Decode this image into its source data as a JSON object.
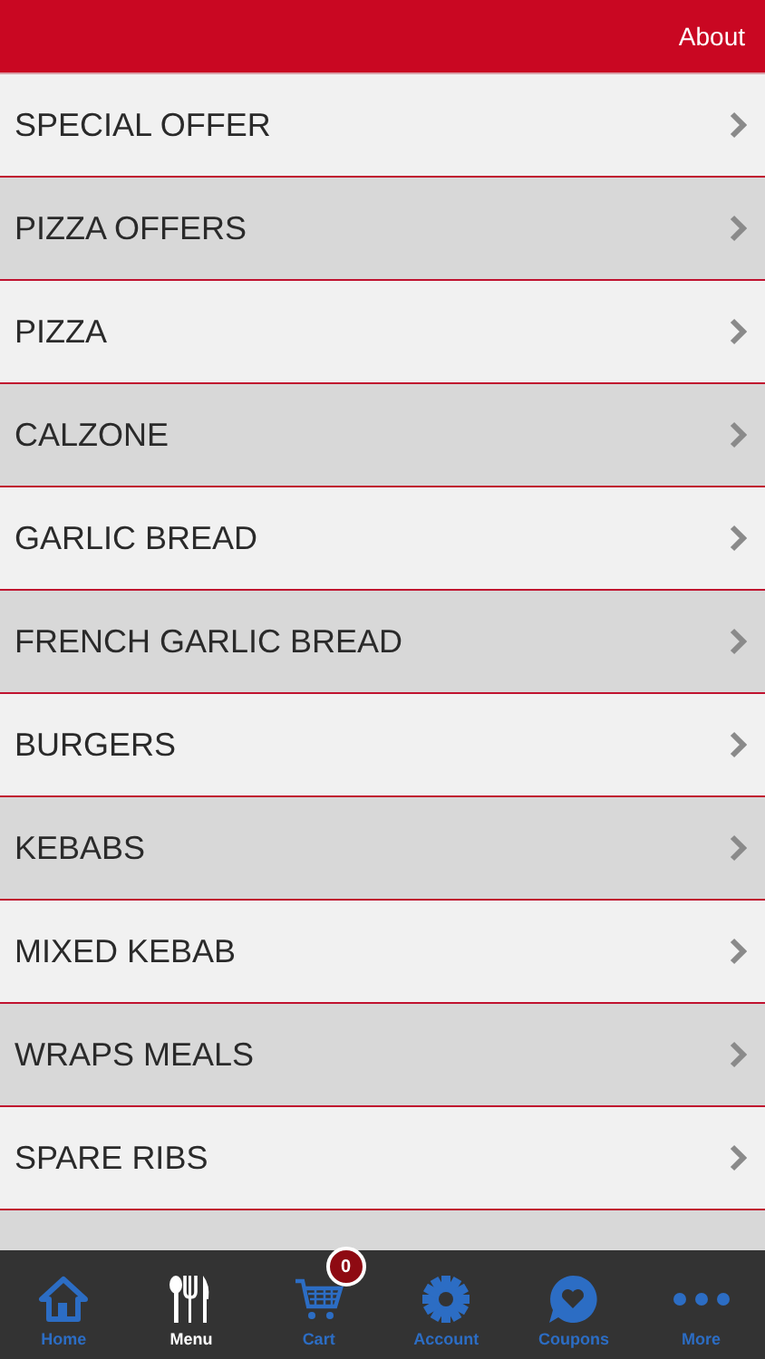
{
  "header": {
    "about": "About"
  },
  "menu_items": [
    {
      "label": "SPECIAL OFFER"
    },
    {
      "label": "PIZZA OFFERS"
    },
    {
      "label": "PIZZA"
    },
    {
      "label": "CALZONE"
    },
    {
      "label": "GARLIC BREAD"
    },
    {
      "label": "FRENCH GARLIC BREAD"
    },
    {
      "label": "BURGERS"
    },
    {
      "label": "KEBABS"
    },
    {
      "label": "MIXED KEBAB"
    },
    {
      "label": "WRAPS MEALS"
    },
    {
      "label": "SPARE RIBS"
    }
  ],
  "tab_bar": [
    {
      "label": "Home",
      "kind": "home",
      "selected": false
    },
    {
      "label": "Menu",
      "kind": "menu",
      "selected": true
    },
    {
      "label": "Cart",
      "kind": "cart",
      "selected": false,
      "badge": "0"
    },
    {
      "label": "Account",
      "kind": "account",
      "selected": false
    },
    {
      "label": "Coupons",
      "kind": "coupons",
      "selected": false
    },
    {
      "label": "More",
      "kind": "more",
      "selected": false
    }
  ]
}
